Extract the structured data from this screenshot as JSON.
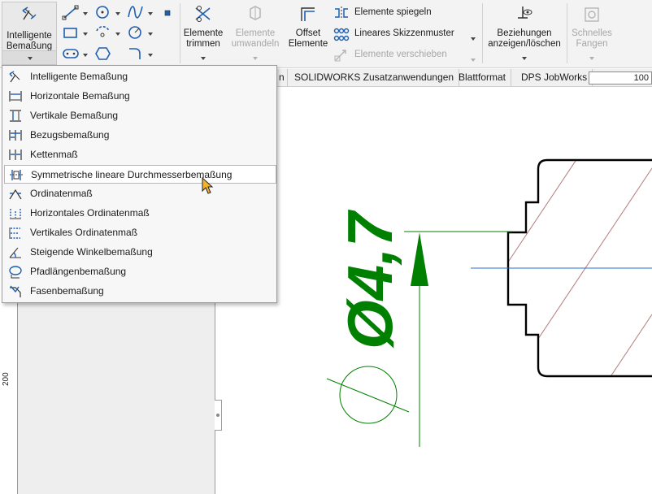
{
  "ribbon": {
    "smart_dimension": {
      "line1": "Intelligente",
      "line2": "Bemaßung",
      "icon": "smart-dimension-icon"
    },
    "sketch_tools": [
      "line-icon",
      "circle-icon",
      "spline-icon",
      "point-icon",
      "rectangle-icon",
      "arc-icon",
      "polygon-icon",
      "slot-icon",
      "hexagon-icon",
      "fillet-icon"
    ],
    "trim": {
      "line1": "Elemente",
      "line2": "trimmen",
      "enabled": true
    },
    "convert": {
      "line1": "Elemente",
      "line2": "umwandeln",
      "enabled": false
    },
    "offset": {
      "line1": "Offset",
      "line2": "Elemente",
      "enabled": true
    },
    "mirror": {
      "label": "Elemente spiegeln",
      "enabled": true
    },
    "linear_pattern": {
      "label": "Lineares Skizzenmuster",
      "enabled": true
    },
    "move": {
      "label": "Elemente verschieben",
      "enabled": false
    },
    "relations": {
      "line1": "Beziehungen",
      "line2": "anzeigen/löschen",
      "enabled": true
    },
    "quick_snaps": {
      "line1": "Schnelles",
      "line2": "Fangen",
      "enabled": false
    }
  },
  "tabs": [
    "n",
    "SOLIDWORKS Zusatzanwendungen",
    "Blattformat",
    "DPS JobWorks"
  ],
  "zoom_value": "100",
  "ruler_label": "200",
  "dimension_text": "Ø4,7",
  "menu": {
    "items": [
      {
        "label": "Intelligente Bemaßung",
        "icon": "smart-dimension-icon"
      },
      {
        "label": "Horizontale Bemaßung",
        "icon": "horizontal-dimension-icon"
      },
      {
        "label": "Vertikale Bemaßung",
        "icon": "vertical-dimension-icon"
      },
      {
        "label": "Bezugsbemaßung",
        "icon": "baseline-dimension-icon"
      },
      {
        "label": "Kettenmaß",
        "icon": "chain-dimension-icon"
      },
      {
        "label": "Symmetrische lineare Durchmesserbemaßung",
        "icon": "symmetric-diameter-dimension-icon",
        "highlighted": true
      },
      {
        "label": "Ordinatenmaß",
        "icon": "ordinate-dimension-icon"
      },
      {
        "label": "Horizontales Ordinatenmaß",
        "icon": "horizontal-ordinate-icon"
      },
      {
        "label": "Vertikales Ordinatenmaß",
        "icon": "vertical-ordinate-icon"
      },
      {
        "label": "Steigende Winkelbemaßung",
        "icon": "angular-running-dimension-icon"
      },
      {
        "label": "Pfadlängenbemaßung",
        "icon": "path-length-dimension-icon"
      },
      {
        "label": "Fasenbemaßung",
        "icon": "chamfer-dimension-icon"
      }
    ]
  },
  "colors": {
    "dimension_green": "#008000",
    "centerline_blue": "#2a6fd6",
    "hatch": "#b07a7a",
    "icon_blue": "#1f5fb0"
  }
}
